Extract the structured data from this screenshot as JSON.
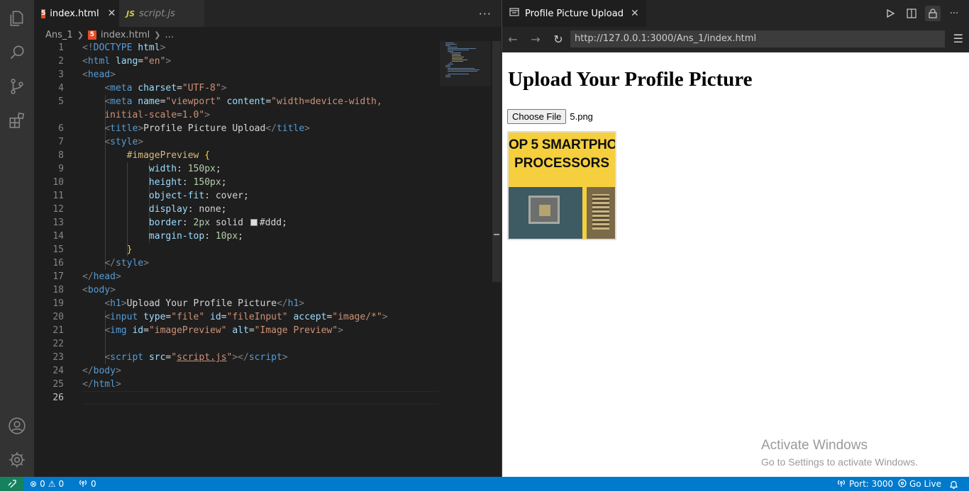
{
  "editor": {
    "tabs": [
      {
        "label": "index.html",
        "icon": "html5-icon",
        "active": true
      },
      {
        "label": "script.js",
        "icon": "js-icon",
        "active": false
      }
    ],
    "js_badge": "JS",
    "breadcrumb": {
      "folder": "Ans_1",
      "file": "index.html",
      "rest": "..."
    },
    "current_line": 26
  },
  "preview": {
    "tab_title": "Profile Picture Upload",
    "url": "http://127.0.0.1:3000/Ans_1/index.html",
    "page": {
      "heading": "Upload Your Profile Picture",
      "choose_file_label": "Choose File",
      "file_name": "5.png",
      "image_text_line1": "OP 5 SMARTPHO",
      "image_text_line2": "PROCESSORS"
    },
    "watermark": {
      "title": "Activate Windows",
      "subtitle": "Go to Settings to activate Windows."
    }
  },
  "status": {
    "errors": "0",
    "warnings": "0",
    "ports": "0",
    "port_label": "Port: 3000",
    "go_live": "Go Live"
  },
  "colors": {
    "status_bar": "#007acc",
    "remote": "#16825d",
    "activity_bar": "#333333",
    "editor_bg": "#1e1e1e"
  }
}
